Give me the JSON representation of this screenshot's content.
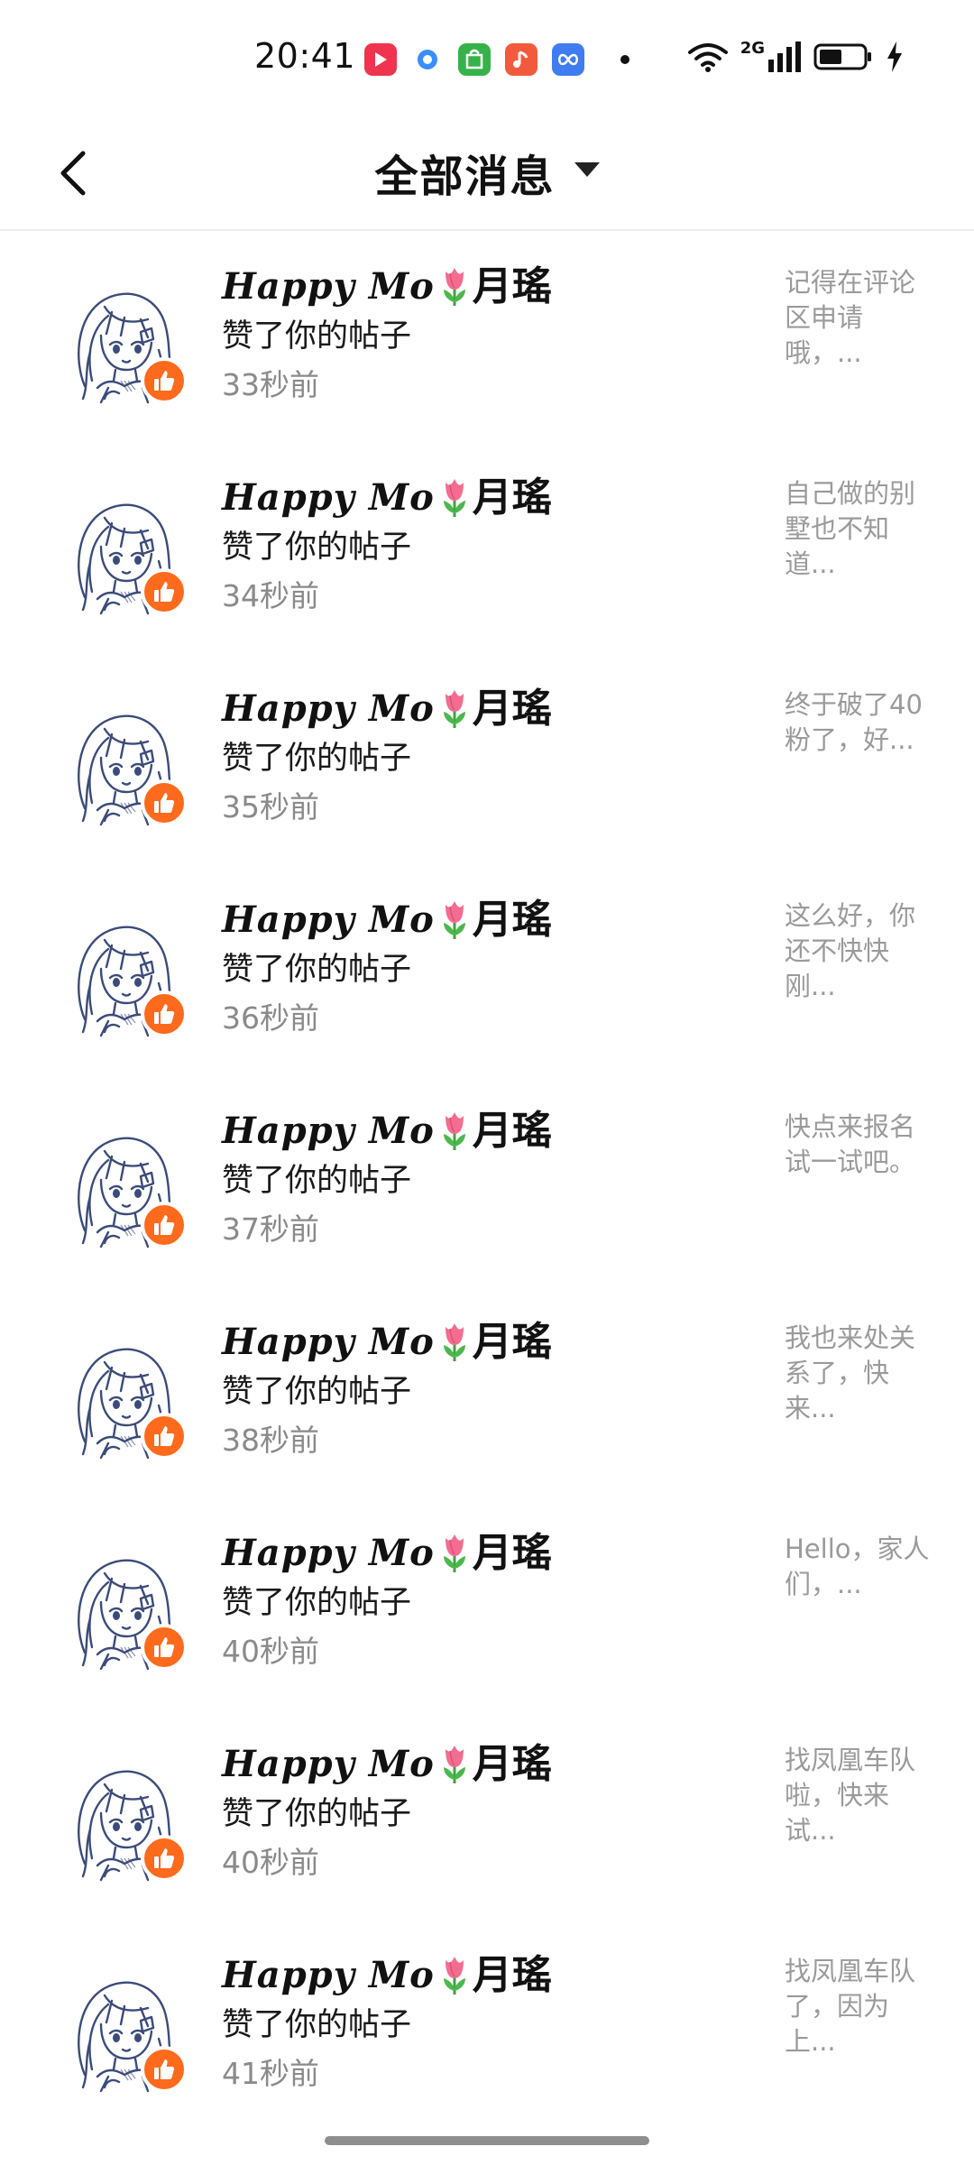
{
  "status_bar": {
    "time": "20:41",
    "network": "2G",
    "apps": [
      {
        "icon": "video-app-icon",
        "color": "#f0334f"
      },
      {
        "icon": "browser-app-icon",
        "color": "#3a8dff"
      },
      {
        "icon": "store-app-icon",
        "color": "#35b34a"
      },
      {
        "icon": "music-app-icon",
        "color": "#f25a3d"
      },
      {
        "icon": "infinity-app-icon",
        "color": "#3f7cf0"
      }
    ]
  },
  "header": {
    "title": "全部消息"
  },
  "colors": {
    "like_badge": "#ff6a1c",
    "secondary_text": "#8a8a8a",
    "preview_text": "#9a9a9a",
    "avatar_stroke": "#3b4b7a"
  },
  "messages": [
    {
      "name_latin": "Happy Mo",
      "name_cjk": "月瑤",
      "action": "赞了你的帖子",
      "time": "33秒前",
      "preview": "记得在评论区申请哦，..."
    },
    {
      "name_latin": "Happy Mo",
      "name_cjk": "月瑤",
      "action": "赞了你的帖子",
      "time": "34秒前",
      "preview": "自己做的别墅也不知道..."
    },
    {
      "name_latin": "Happy Mo",
      "name_cjk": "月瑤",
      "action": "赞了你的帖子",
      "time": "35秒前",
      "preview": "终于破了40粉了，好..."
    },
    {
      "name_latin": "Happy Mo",
      "name_cjk": "月瑤",
      "action": "赞了你的帖子",
      "time": "36秒前",
      "preview": "这么好，你还不快快刚..."
    },
    {
      "name_latin": "Happy Mo",
      "name_cjk": "月瑤",
      "action": "赞了你的帖子",
      "time": "37秒前",
      "preview": "快点来报名试一试吧。"
    },
    {
      "name_latin": "Happy Mo",
      "name_cjk": "月瑤",
      "action": "赞了你的帖子",
      "time": "38秒前",
      "preview": "我也来处关系了，快来..."
    },
    {
      "name_latin": "Happy Mo",
      "name_cjk": "月瑤",
      "action": "赞了你的帖子",
      "time": "40秒前",
      "preview": "Hello，家人们，..."
    },
    {
      "name_latin": "Happy Mo",
      "name_cjk": "月瑤",
      "action": "赞了你的帖子",
      "time": "40秒前",
      "preview": "找凤凰车队啦，快来试..."
    },
    {
      "name_latin": "Happy Mo",
      "name_cjk": "月瑤",
      "action": "赞了你的帖子",
      "time": "41秒前",
      "preview": "找凤凰车队了，因为上..."
    }
  ]
}
